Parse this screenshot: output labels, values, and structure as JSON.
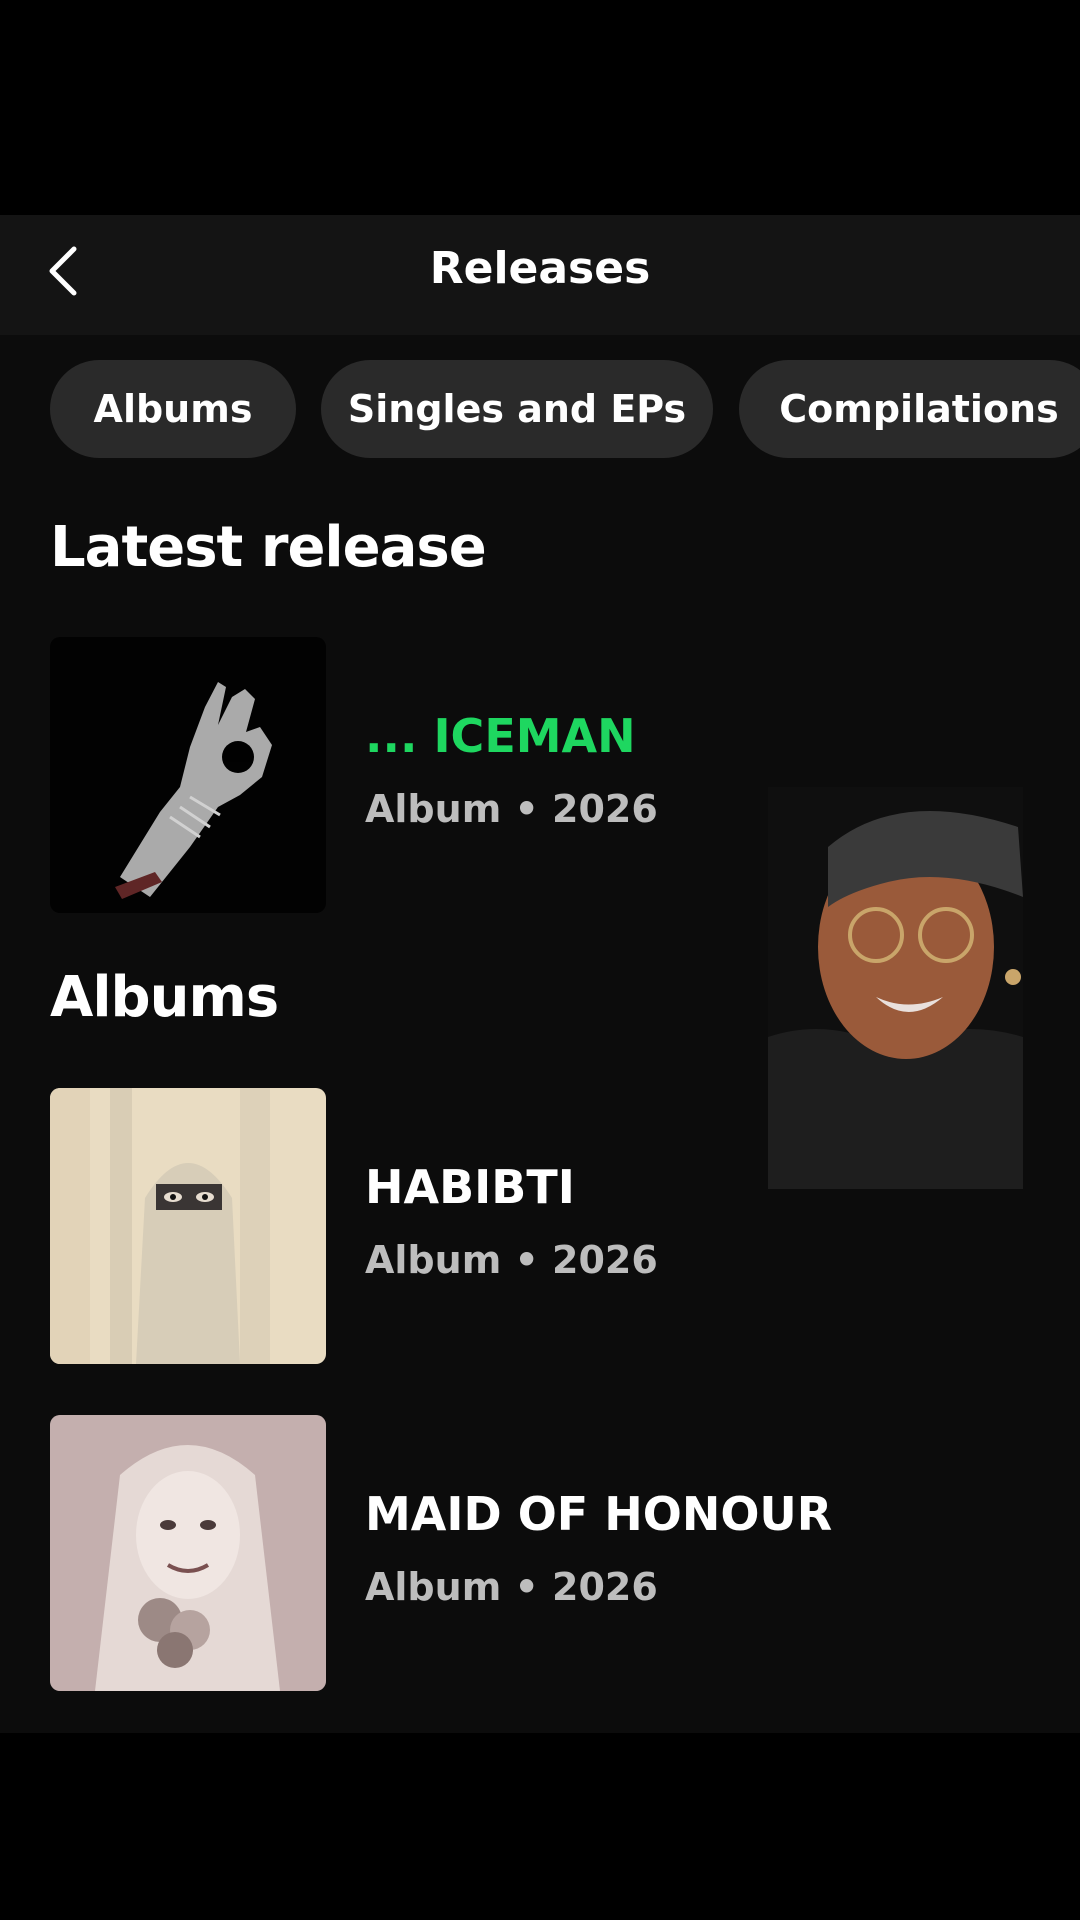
{
  "header": {
    "title": "Releases"
  },
  "filters": [
    "Albums",
    "Singles and EPs",
    "Compilations"
  ],
  "latest": {
    "heading": "Latest release",
    "item": {
      "title": "... ICEMAN",
      "subtitle": "Album • 2026",
      "title_color": "#1ed760"
    }
  },
  "albums": {
    "heading": "Albums",
    "items": [
      {
        "title": "HABIBTI",
        "subtitle": "Album • 2026"
      },
      {
        "title": "MAID OF HONOUR",
        "subtitle": "Album • 2026"
      }
    ]
  }
}
